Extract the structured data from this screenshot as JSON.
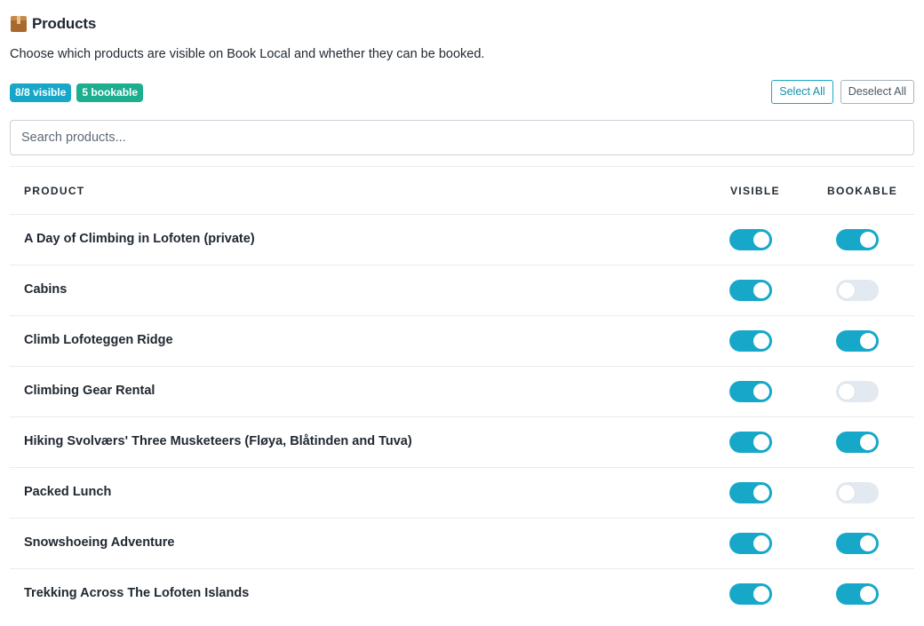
{
  "header": {
    "icon": "package-icon",
    "title": "Products"
  },
  "description": "Choose which products are visible on Book Local and whether they can be booked.",
  "badges": {
    "visible": "8/8 visible",
    "bookable": "5 bookable"
  },
  "actions": {
    "select_all": "Select All",
    "deselect_all": "Deselect All"
  },
  "search": {
    "placeholder": "Search products...",
    "value": ""
  },
  "table": {
    "columns": {
      "product": "PRODUCT",
      "visible": "VISIBLE",
      "bookable": "BOOKABLE"
    },
    "rows": [
      {
        "name": "A Day of Climbing in Lofoten (private)",
        "visible": true,
        "bookable": true
      },
      {
        "name": "Cabins",
        "visible": true,
        "bookable": false
      },
      {
        "name": "Climb Lofoteggen Ridge",
        "visible": true,
        "bookable": true
      },
      {
        "name": "Climbing Gear Rental",
        "visible": true,
        "bookable": false
      },
      {
        "name": "Hiking Svolværs' Three Musketeers (Fløya, Blåtinden and Tuva)",
        "visible": true,
        "bookable": true
      },
      {
        "name": "Packed Lunch",
        "visible": true,
        "bookable": false
      },
      {
        "name": "Snowshoeing Adventure",
        "visible": true,
        "bookable": true
      },
      {
        "name": "Trekking Across The Lofoten Islands",
        "visible": true,
        "bookable": true
      }
    ]
  },
  "colors": {
    "accent": "#17a8c9",
    "bookable_badge": "#1cae8e",
    "toggle_off": "#e3e9f0"
  }
}
